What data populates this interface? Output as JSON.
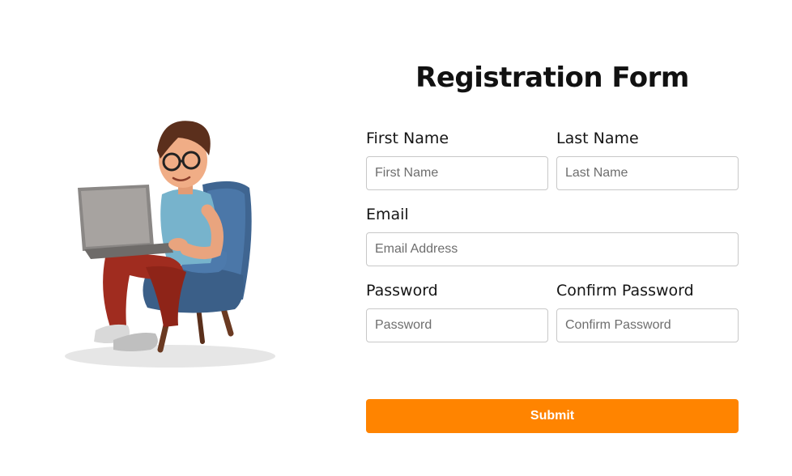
{
  "form": {
    "title": "Registration Form",
    "first_name": {
      "label": "First Name",
      "placeholder": "First Name",
      "value": ""
    },
    "last_name": {
      "label": "Last Name",
      "placeholder": "Last Name",
      "value": ""
    },
    "email": {
      "label": "Email",
      "placeholder": "Email Address",
      "value": ""
    },
    "password": {
      "label": "Password",
      "placeholder": "Password",
      "value": ""
    },
    "confirm_password": {
      "label": "Confirm Password",
      "placeholder": "Confirm Password",
      "value": ""
    },
    "submit_label": "Submit"
  },
  "colors": {
    "accent": "#ff8400",
    "border": "#c8c8c8",
    "text": "#111111"
  },
  "illustration": {
    "icon": "person-with-laptop-illustration"
  }
}
